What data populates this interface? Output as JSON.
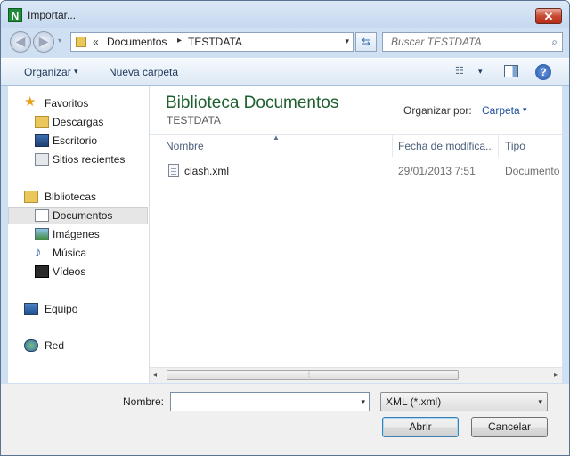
{
  "window": {
    "title": "Importar...",
    "close_glyph": "✕",
    "app_icon_letter": "N"
  },
  "address": {
    "overflow": "«",
    "crumbs": [
      "Documentos",
      "TESTDATA"
    ],
    "separator": "▸",
    "dropdown_glyph": "▾",
    "refresh_glyph": "⇆"
  },
  "search": {
    "placeholder": "Buscar TESTDATA",
    "icon_glyph": "⌕"
  },
  "toolbar": {
    "organize_label": "Organizar",
    "new_folder_label": "Nueva carpeta",
    "caret": "▾",
    "help_glyph": "?"
  },
  "sidebar": {
    "favorites_label": "Favoritos",
    "favorites": [
      "Descargas",
      "Escritorio",
      "Sitios recientes"
    ],
    "libraries_label": "Bibliotecas",
    "libraries": [
      "Documentos",
      "Imágenes",
      "Música",
      "Vídeos"
    ],
    "selected": "Documentos",
    "computer_label": "Equipo",
    "network_label": "Red"
  },
  "content": {
    "library_title": "Biblioteca Documentos",
    "library_subtitle": "TESTDATA",
    "arrange_label": "Organizar por:",
    "arrange_value": "Carpeta",
    "columns": [
      "Nombre",
      "Fecha de modifica...",
      "Tipo"
    ],
    "files": [
      {
        "name": "clash.xml",
        "date": "29/01/2013 7:51",
        "type": "Documento"
      }
    ]
  },
  "scrollbar": {
    "left": "◂",
    "right": "▸",
    "grip": "⦙"
  },
  "footer": {
    "name_label": "Nombre:",
    "name_value": "",
    "filetype_value": "XML (*.xml)",
    "open_label": "Abrir",
    "cancel_label": "Cancelar"
  },
  "icon_names": {
    "favorites": "star-icon",
    "downloads": "download-folder-icon",
    "desktop": "desktop-icon",
    "recent": "recent-places-icon",
    "libraries": "library-icon",
    "documents": "documents-icon",
    "pictures": "pictures-icon",
    "music": "music-icon",
    "videos": "videos-icon",
    "computer": "computer-icon",
    "network": "network-icon"
  }
}
